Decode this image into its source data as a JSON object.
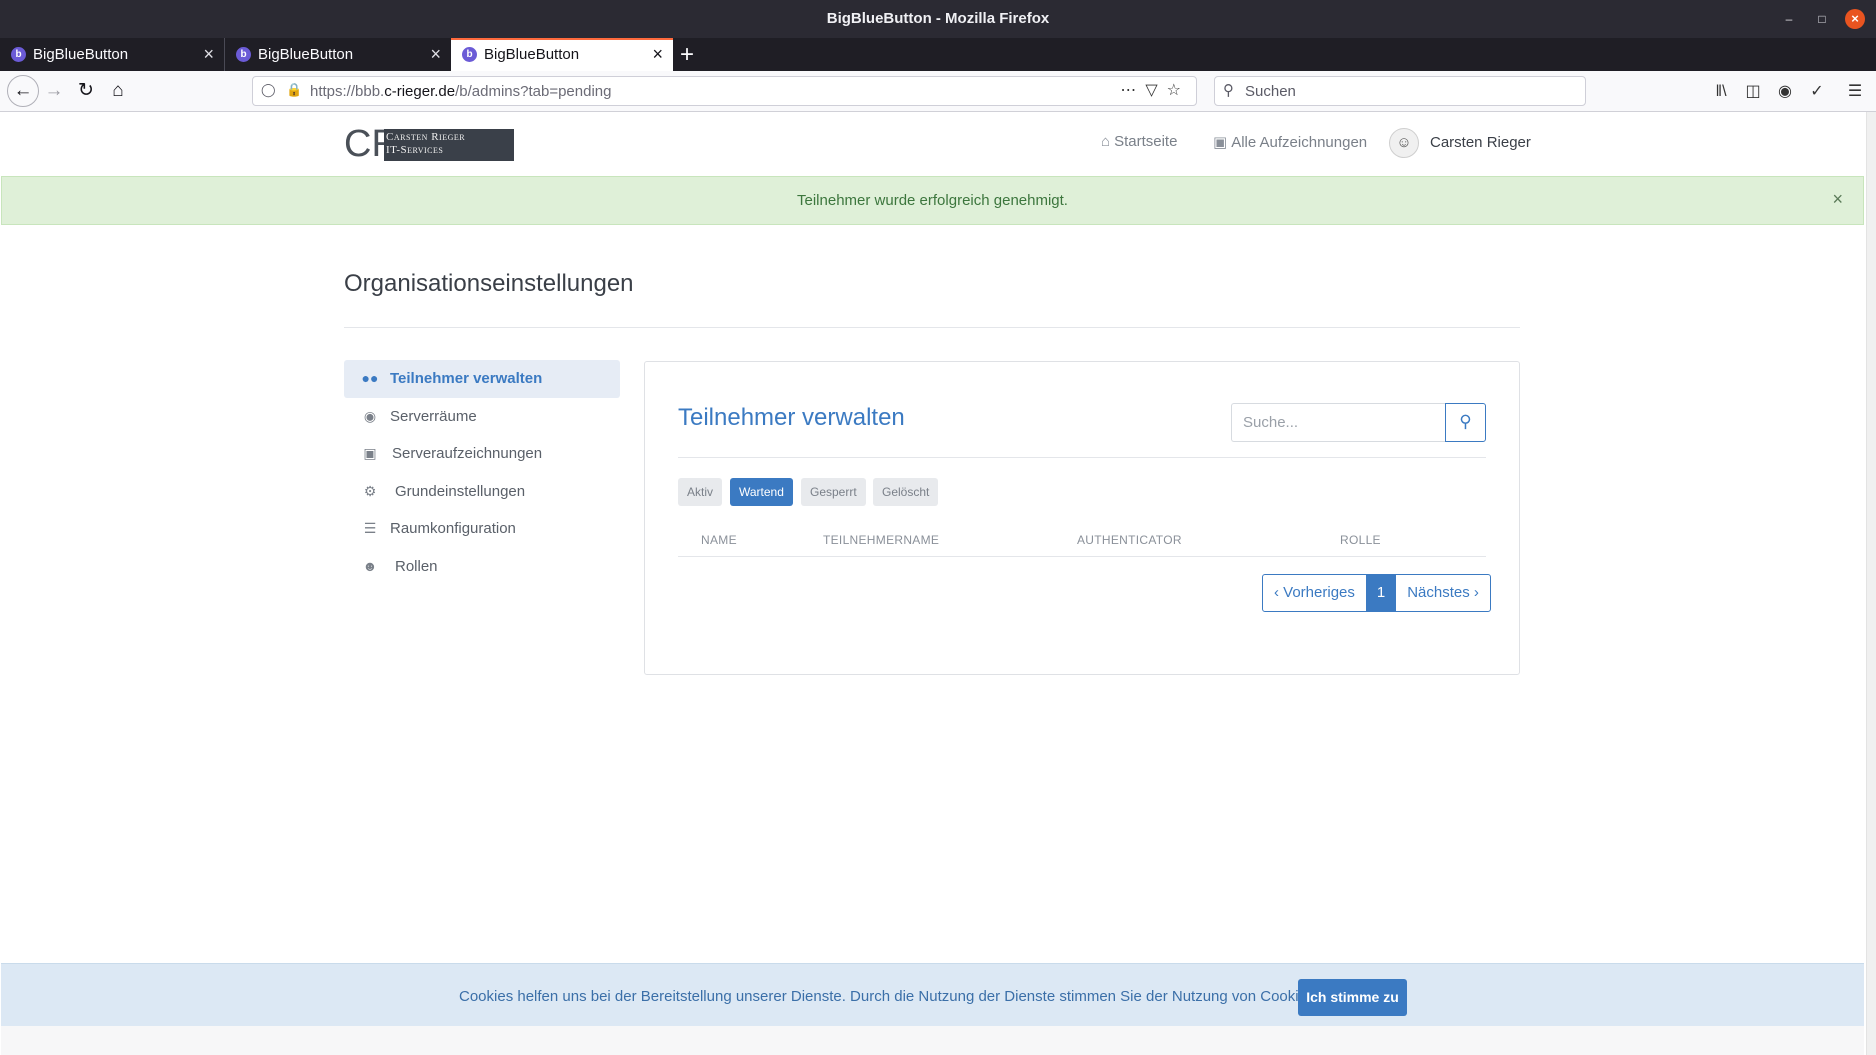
{
  "window": {
    "title": "BigBlueButton - Mozilla Firefox"
  },
  "tabs": [
    {
      "label": "BigBlueButton",
      "favicon": "b"
    },
    {
      "label": "BigBlueButton",
      "favicon": "b"
    },
    {
      "label": "BigBlueButton",
      "favicon": "b"
    }
  ],
  "address": {
    "url_prefix": "https://bbb.",
    "url_domain": "c-rieger.de",
    "url_suffix": "/b/admins?tab=pending",
    "search_placeholder": "Suchen"
  },
  "site": {
    "logo_initials": "CR",
    "logo_line1": "Carsten Rieger",
    "logo_line2": "IT-Services",
    "nav_home": "Startseite",
    "nav_recordings": "Alle Aufzeichnungen",
    "user_name": "Carsten Rieger"
  },
  "flash": {
    "message": "Teilnehmer wurde erfolgreich genehmigt."
  },
  "page": {
    "title": "Organisationseinstellungen"
  },
  "sidebar": {
    "items": [
      {
        "label": "Teilnehmer verwalten",
        "icon": "users-icon",
        "active": true
      },
      {
        "label": "Serverräume",
        "icon": "binoculars-icon",
        "active": false
      },
      {
        "label": "Serveraufzeichnungen",
        "icon": "video-icon",
        "active": false
      },
      {
        "label": "Grundeinstellungen",
        "icon": "cogs-icon",
        "active": false
      },
      {
        "label": "Raumkonfiguration",
        "icon": "sliders-icon",
        "active": false
      },
      {
        "label": "Rollen",
        "icon": "user-cog-icon",
        "active": false
      }
    ]
  },
  "panel": {
    "title": "Teilnehmer verwalten",
    "search_placeholder": "Suche...",
    "filters": [
      "Aktiv",
      "Wartend",
      "Gesperrt",
      "Gelöscht"
    ],
    "active_filter": "Wartend",
    "columns": [
      "NAME",
      "TEILNEHMERNAME",
      "AUTHENTICATOR",
      "ROLLE"
    ],
    "rows": [],
    "pagination": {
      "prev": "‹ Vorheriges",
      "current": "1",
      "next": "Nächstes ›"
    }
  },
  "cookie": {
    "text": "Cookies helfen uns bei der Bereitstellung unserer Dienste. Durch die Nutzung der Dienste stimmen Sie der Nutzung von Cookies zu.",
    "accept": "Ich stimme zu"
  },
  "colors": {
    "accent": "#3b7ac2",
    "success_bg": "#dff0d8",
    "success_text": "#3c763d",
    "titlebar": "#2b2a33"
  }
}
